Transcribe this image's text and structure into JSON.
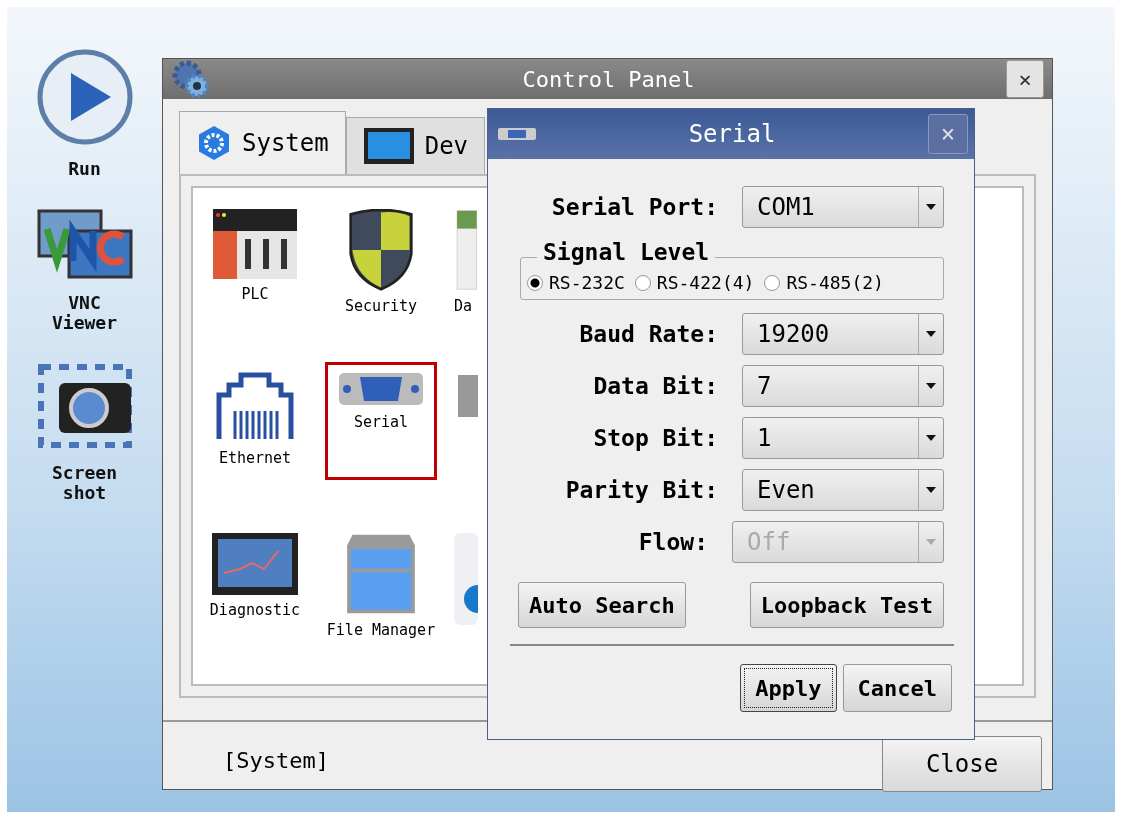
{
  "sidebar": {
    "items": [
      {
        "kind": "run",
        "label": "Run"
      },
      {
        "kind": "vnc",
        "label": "VNC Viewer"
      },
      {
        "kind": "screenshot",
        "label": "Screen shot"
      }
    ]
  },
  "control_panel": {
    "title": "Control Panel",
    "close": "×",
    "tabs": [
      {
        "label": "System",
        "kind": "system",
        "selected": true
      },
      {
        "label": "Dev",
        "kind": "device",
        "selected": false
      }
    ],
    "items": [
      {
        "label": "PLC",
        "kind": "plc",
        "selected": false
      },
      {
        "label": "Security",
        "kind": "security",
        "selected": false
      },
      {
        "label": "Da",
        "kind": "partial-green",
        "selected": false
      },
      {
        "label": "Ethernet",
        "kind": "ethernet",
        "selected": false
      },
      {
        "label": "Serial",
        "kind": "serial",
        "selected": true
      },
      {
        "kind": "partial-gray",
        "selected": false
      },
      {
        "label": "Diagnostic",
        "kind": "diagnostic",
        "selected": false
      },
      {
        "label": "File Manager",
        "kind": "file",
        "selected": false
      },
      {
        "kind": "partial-blue",
        "selected": false
      }
    ],
    "status": "[System]",
    "close_button": "Close"
  },
  "serial_dialog": {
    "title": "Serial",
    "close": "×",
    "serial_port": {
      "label": "Serial Port:",
      "value": "COM1"
    },
    "signal_level": {
      "legend": "Signal Level",
      "options": [
        {
          "label": "RS-232C",
          "selected": true
        },
        {
          "label": "RS-422(4)",
          "selected": false
        },
        {
          "label": "RS-485(2)",
          "selected": false
        }
      ]
    },
    "settings": [
      {
        "label": "Baud Rate:",
        "value": "19200",
        "disabled": false
      },
      {
        "label": "Data Bit:",
        "value": "7",
        "disabled": false
      },
      {
        "label": "Stop Bit:",
        "value": "1",
        "disabled": false
      },
      {
        "label": "Parity Bit:",
        "value": "Even",
        "disabled": false
      },
      {
        "label": "Flow:",
        "value": "Off",
        "disabled": true
      }
    ],
    "actions": [
      "Auto Search",
      "Loopback Test"
    ],
    "buttons": [
      {
        "label": "Apply",
        "focused": true
      },
      {
        "label": "Cancel",
        "focused": false
      }
    ]
  }
}
